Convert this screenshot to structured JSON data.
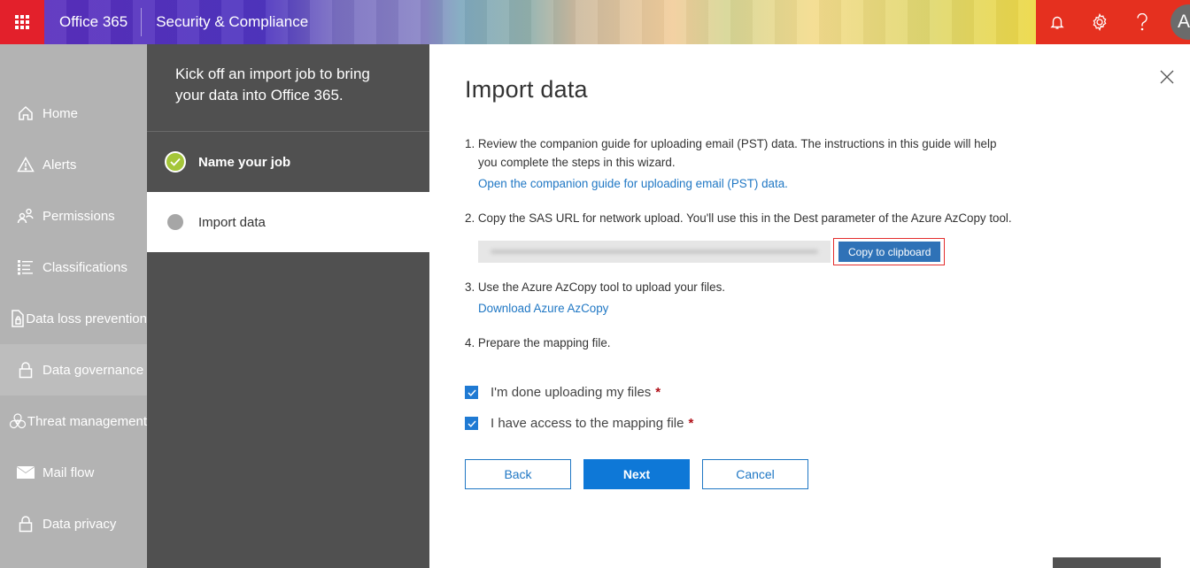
{
  "topbar": {
    "brand": "Office 365",
    "app_name": "Security & Compliance",
    "avatar_initial": "A",
    "icons": [
      "waffle-icon",
      "bell-icon",
      "gear-icon",
      "help-icon"
    ],
    "colors": {
      "waffle_bg": "#e3202b",
      "right_bg": "#e5301f"
    }
  },
  "leftnav": {
    "items": [
      {
        "label": "Home",
        "icon": "home-icon"
      },
      {
        "label": "Alerts",
        "icon": "alert-icon"
      },
      {
        "label": "Permissions",
        "icon": "permissions-icon"
      },
      {
        "label": "Classifications",
        "icon": "classifications-icon"
      },
      {
        "label": "Data loss prevention",
        "icon": "dlp-icon"
      },
      {
        "label": "Data governance",
        "icon": "lock-icon",
        "active": true
      },
      {
        "label": "Threat management",
        "icon": "biohazard-icon"
      },
      {
        "label": "Mail flow",
        "icon": "mail-icon"
      },
      {
        "label": "Data privacy",
        "icon": "lock-icon"
      }
    ]
  },
  "wizard": {
    "intro": "Kick off an import job to bring your data into Office 365.",
    "steps": [
      {
        "label": "Name your job",
        "state": "done"
      },
      {
        "label": "Import data",
        "state": "current"
      }
    ],
    "colors": {
      "done": "#a4c639",
      "pending": "#a6a6a6"
    }
  },
  "main": {
    "title": "Import data",
    "step1_text": "1. Review the companion guide for uploading email (PST) data. The instructions in this guide will help",
    "step1_text_cont": "you complete the steps in this wizard.",
    "step1_link": "Open the companion guide for uploading email (PST) data.",
    "step2_text": "2. Copy the SAS URL for network upload. You'll use this in the Dest parameter of the Azure AzCopy tool.",
    "sas_url_value": "(blurred)",
    "copy_button": "Copy to clipboard",
    "step3_text": "3. Use the Azure AzCopy tool to upload your files.",
    "step3_link": "Download Azure AzCopy",
    "step4_text": "4. Prepare the mapping file.",
    "checkboxes": [
      {
        "label": "I'm done uploading my files",
        "checked": true,
        "required_mark": "*"
      },
      {
        "label": "I have access to the mapping file",
        "checked": true,
        "required_mark": "*"
      }
    ],
    "buttons": {
      "back": "Back",
      "next": "Next",
      "cancel": "Cancel"
    },
    "colors": {
      "link": "#1f77c4",
      "primary": "#0e78d7",
      "highlight_outline": "#e32d2d"
    }
  }
}
